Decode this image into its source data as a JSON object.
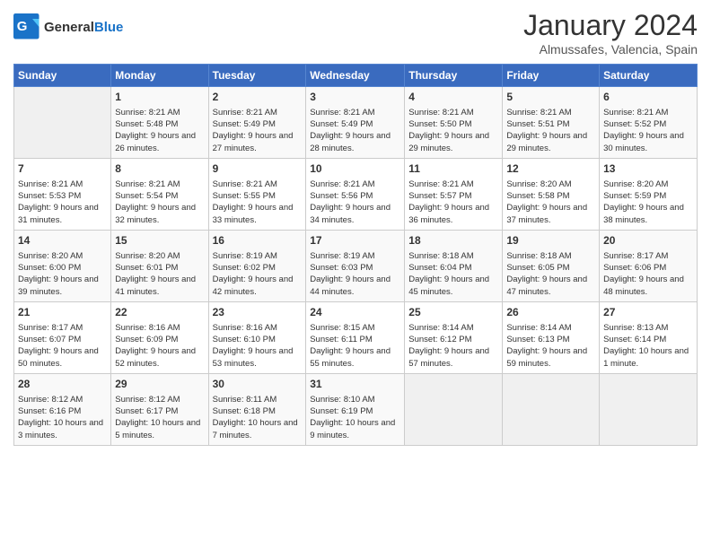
{
  "header": {
    "logo_general": "General",
    "logo_blue": "Blue",
    "month": "January 2024",
    "location": "Almussafes, Valencia, Spain"
  },
  "days_of_week": [
    "Sunday",
    "Monday",
    "Tuesday",
    "Wednesday",
    "Thursday",
    "Friday",
    "Saturday"
  ],
  "weeks": [
    [
      {
        "day": "",
        "empty": true
      },
      {
        "day": "1",
        "sunrise": "Sunrise: 8:21 AM",
        "sunset": "Sunset: 5:48 PM",
        "daylight": "Daylight: 9 hours and 26 minutes."
      },
      {
        "day": "2",
        "sunrise": "Sunrise: 8:21 AM",
        "sunset": "Sunset: 5:49 PM",
        "daylight": "Daylight: 9 hours and 27 minutes."
      },
      {
        "day": "3",
        "sunrise": "Sunrise: 8:21 AM",
        "sunset": "Sunset: 5:49 PM",
        "daylight": "Daylight: 9 hours and 28 minutes."
      },
      {
        "day": "4",
        "sunrise": "Sunrise: 8:21 AM",
        "sunset": "Sunset: 5:50 PM",
        "daylight": "Daylight: 9 hours and 29 minutes."
      },
      {
        "day": "5",
        "sunrise": "Sunrise: 8:21 AM",
        "sunset": "Sunset: 5:51 PM",
        "daylight": "Daylight: 9 hours and 29 minutes."
      },
      {
        "day": "6",
        "sunrise": "Sunrise: 8:21 AM",
        "sunset": "Sunset: 5:52 PM",
        "daylight": "Daylight: 9 hours and 30 minutes."
      }
    ],
    [
      {
        "day": "7",
        "sunrise": "Sunrise: 8:21 AM",
        "sunset": "Sunset: 5:53 PM",
        "daylight": "Daylight: 9 hours and 31 minutes."
      },
      {
        "day": "8",
        "sunrise": "Sunrise: 8:21 AM",
        "sunset": "Sunset: 5:54 PM",
        "daylight": "Daylight: 9 hours and 32 minutes."
      },
      {
        "day": "9",
        "sunrise": "Sunrise: 8:21 AM",
        "sunset": "Sunset: 5:55 PM",
        "daylight": "Daylight: 9 hours and 33 minutes."
      },
      {
        "day": "10",
        "sunrise": "Sunrise: 8:21 AM",
        "sunset": "Sunset: 5:56 PM",
        "daylight": "Daylight: 9 hours and 34 minutes."
      },
      {
        "day": "11",
        "sunrise": "Sunrise: 8:21 AM",
        "sunset": "Sunset: 5:57 PM",
        "daylight": "Daylight: 9 hours and 36 minutes."
      },
      {
        "day": "12",
        "sunrise": "Sunrise: 8:20 AM",
        "sunset": "Sunset: 5:58 PM",
        "daylight": "Daylight: 9 hours and 37 minutes."
      },
      {
        "day": "13",
        "sunrise": "Sunrise: 8:20 AM",
        "sunset": "Sunset: 5:59 PM",
        "daylight": "Daylight: 9 hours and 38 minutes."
      }
    ],
    [
      {
        "day": "14",
        "sunrise": "Sunrise: 8:20 AM",
        "sunset": "Sunset: 6:00 PM",
        "daylight": "Daylight: 9 hours and 39 minutes."
      },
      {
        "day": "15",
        "sunrise": "Sunrise: 8:20 AM",
        "sunset": "Sunset: 6:01 PM",
        "daylight": "Daylight: 9 hours and 41 minutes."
      },
      {
        "day": "16",
        "sunrise": "Sunrise: 8:19 AM",
        "sunset": "Sunset: 6:02 PM",
        "daylight": "Daylight: 9 hours and 42 minutes."
      },
      {
        "day": "17",
        "sunrise": "Sunrise: 8:19 AM",
        "sunset": "Sunset: 6:03 PM",
        "daylight": "Daylight: 9 hours and 44 minutes."
      },
      {
        "day": "18",
        "sunrise": "Sunrise: 8:18 AM",
        "sunset": "Sunset: 6:04 PM",
        "daylight": "Daylight: 9 hours and 45 minutes."
      },
      {
        "day": "19",
        "sunrise": "Sunrise: 8:18 AM",
        "sunset": "Sunset: 6:05 PM",
        "daylight": "Daylight: 9 hours and 47 minutes."
      },
      {
        "day": "20",
        "sunrise": "Sunrise: 8:17 AM",
        "sunset": "Sunset: 6:06 PM",
        "daylight": "Daylight: 9 hours and 48 minutes."
      }
    ],
    [
      {
        "day": "21",
        "sunrise": "Sunrise: 8:17 AM",
        "sunset": "Sunset: 6:07 PM",
        "daylight": "Daylight: 9 hours and 50 minutes."
      },
      {
        "day": "22",
        "sunrise": "Sunrise: 8:16 AM",
        "sunset": "Sunset: 6:09 PM",
        "daylight": "Daylight: 9 hours and 52 minutes."
      },
      {
        "day": "23",
        "sunrise": "Sunrise: 8:16 AM",
        "sunset": "Sunset: 6:10 PM",
        "daylight": "Daylight: 9 hours and 53 minutes."
      },
      {
        "day": "24",
        "sunrise": "Sunrise: 8:15 AM",
        "sunset": "Sunset: 6:11 PM",
        "daylight": "Daylight: 9 hours and 55 minutes."
      },
      {
        "day": "25",
        "sunrise": "Sunrise: 8:14 AM",
        "sunset": "Sunset: 6:12 PM",
        "daylight": "Daylight: 9 hours and 57 minutes."
      },
      {
        "day": "26",
        "sunrise": "Sunrise: 8:14 AM",
        "sunset": "Sunset: 6:13 PM",
        "daylight": "Daylight: 9 hours and 59 minutes."
      },
      {
        "day": "27",
        "sunrise": "Sunrise: 8:13 AM",
        "sunset": "Sunset: 6:14 PM",
        "daylight": "Daylight: 10 hours and 1 minute."
      }
    ],
    [
      {
        "day": "28",
        "sunrise": "Sunrise: 8:12 AM",
        "sunset": "Sunset: 6:16 PM",
        "daylight": "Daylight: 10 hours and 3 minutes."
      },
      {
        "day": "29",
        "sunrise": "Sunrise: 8:12 AM",
        "sunset": "Sunset: 6:17 PM",
        "daylight": "Daylight: 10 hours and 5 minutes."
      },
      {
        "day": "30",
        "sunrise": "Sunrise: 8:11 AM",
        "sunset": "Sunset: 6:18 PM",
        "daylight": "Daylight: 10 hours and 7 minutes."
      },
      {
        "day": "31",
        "sunrise": "Sunrise: 8:10 AM",
        "sunset": "Sunset: 6:19 PM",
        "daylight": "Daylight: 10 hours and 9 minutes."
      },
      {
        "day": "",
        "empty": true
      },
      {
        "day": "",
        "empty": true
      },
      {
        "day": "",
        "empty": true
      }
    ]
  ]
}
